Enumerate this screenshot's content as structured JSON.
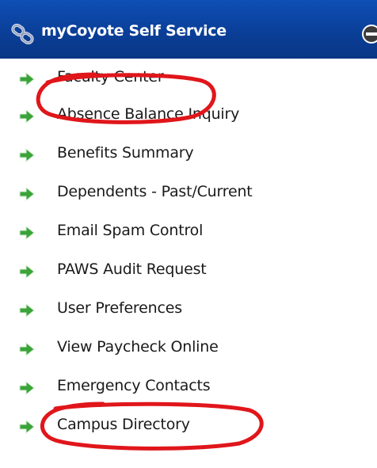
{
  "header": {
    "title": "myCoyote Self Service",
    "icon": "chain-link-icon",
    "collapse_icon": "minus-circle-icon",
    "background_color": "#0a3f98"
  },
  "menu": {
    "bullet_icon": "green-arrow-icon",
    "bullet_color": "#3aa339",
    "items": [
      {
        "label": "Faculty Center",
        "circled": true
      },
      {
        "label": "Absence Balance Inquiry",
        "circled": false
      },
      {
        "label": "Benefits Summary",
        "circled": false
      },
      {
        "label": "Dependents - Past/Current",
        "circled": false
      },
      {
        "label": "Email Spam Control",
        "circled": false
      },
      {
        "label": "PAWS Audit Request",
        "circled": false
      },
      {
        "label": "User Preferences",
        "circled": false
      },
      {
        "label": "View Paycheck Online",
        "circled": false
      },
      {
        "label": "Emergency Contacts",
        "circled": true
      },
      {
        "label": "Campus Directory",
        "circled": false
      }
    ]
  },
  "annotation_color": "#e0161b"
}
